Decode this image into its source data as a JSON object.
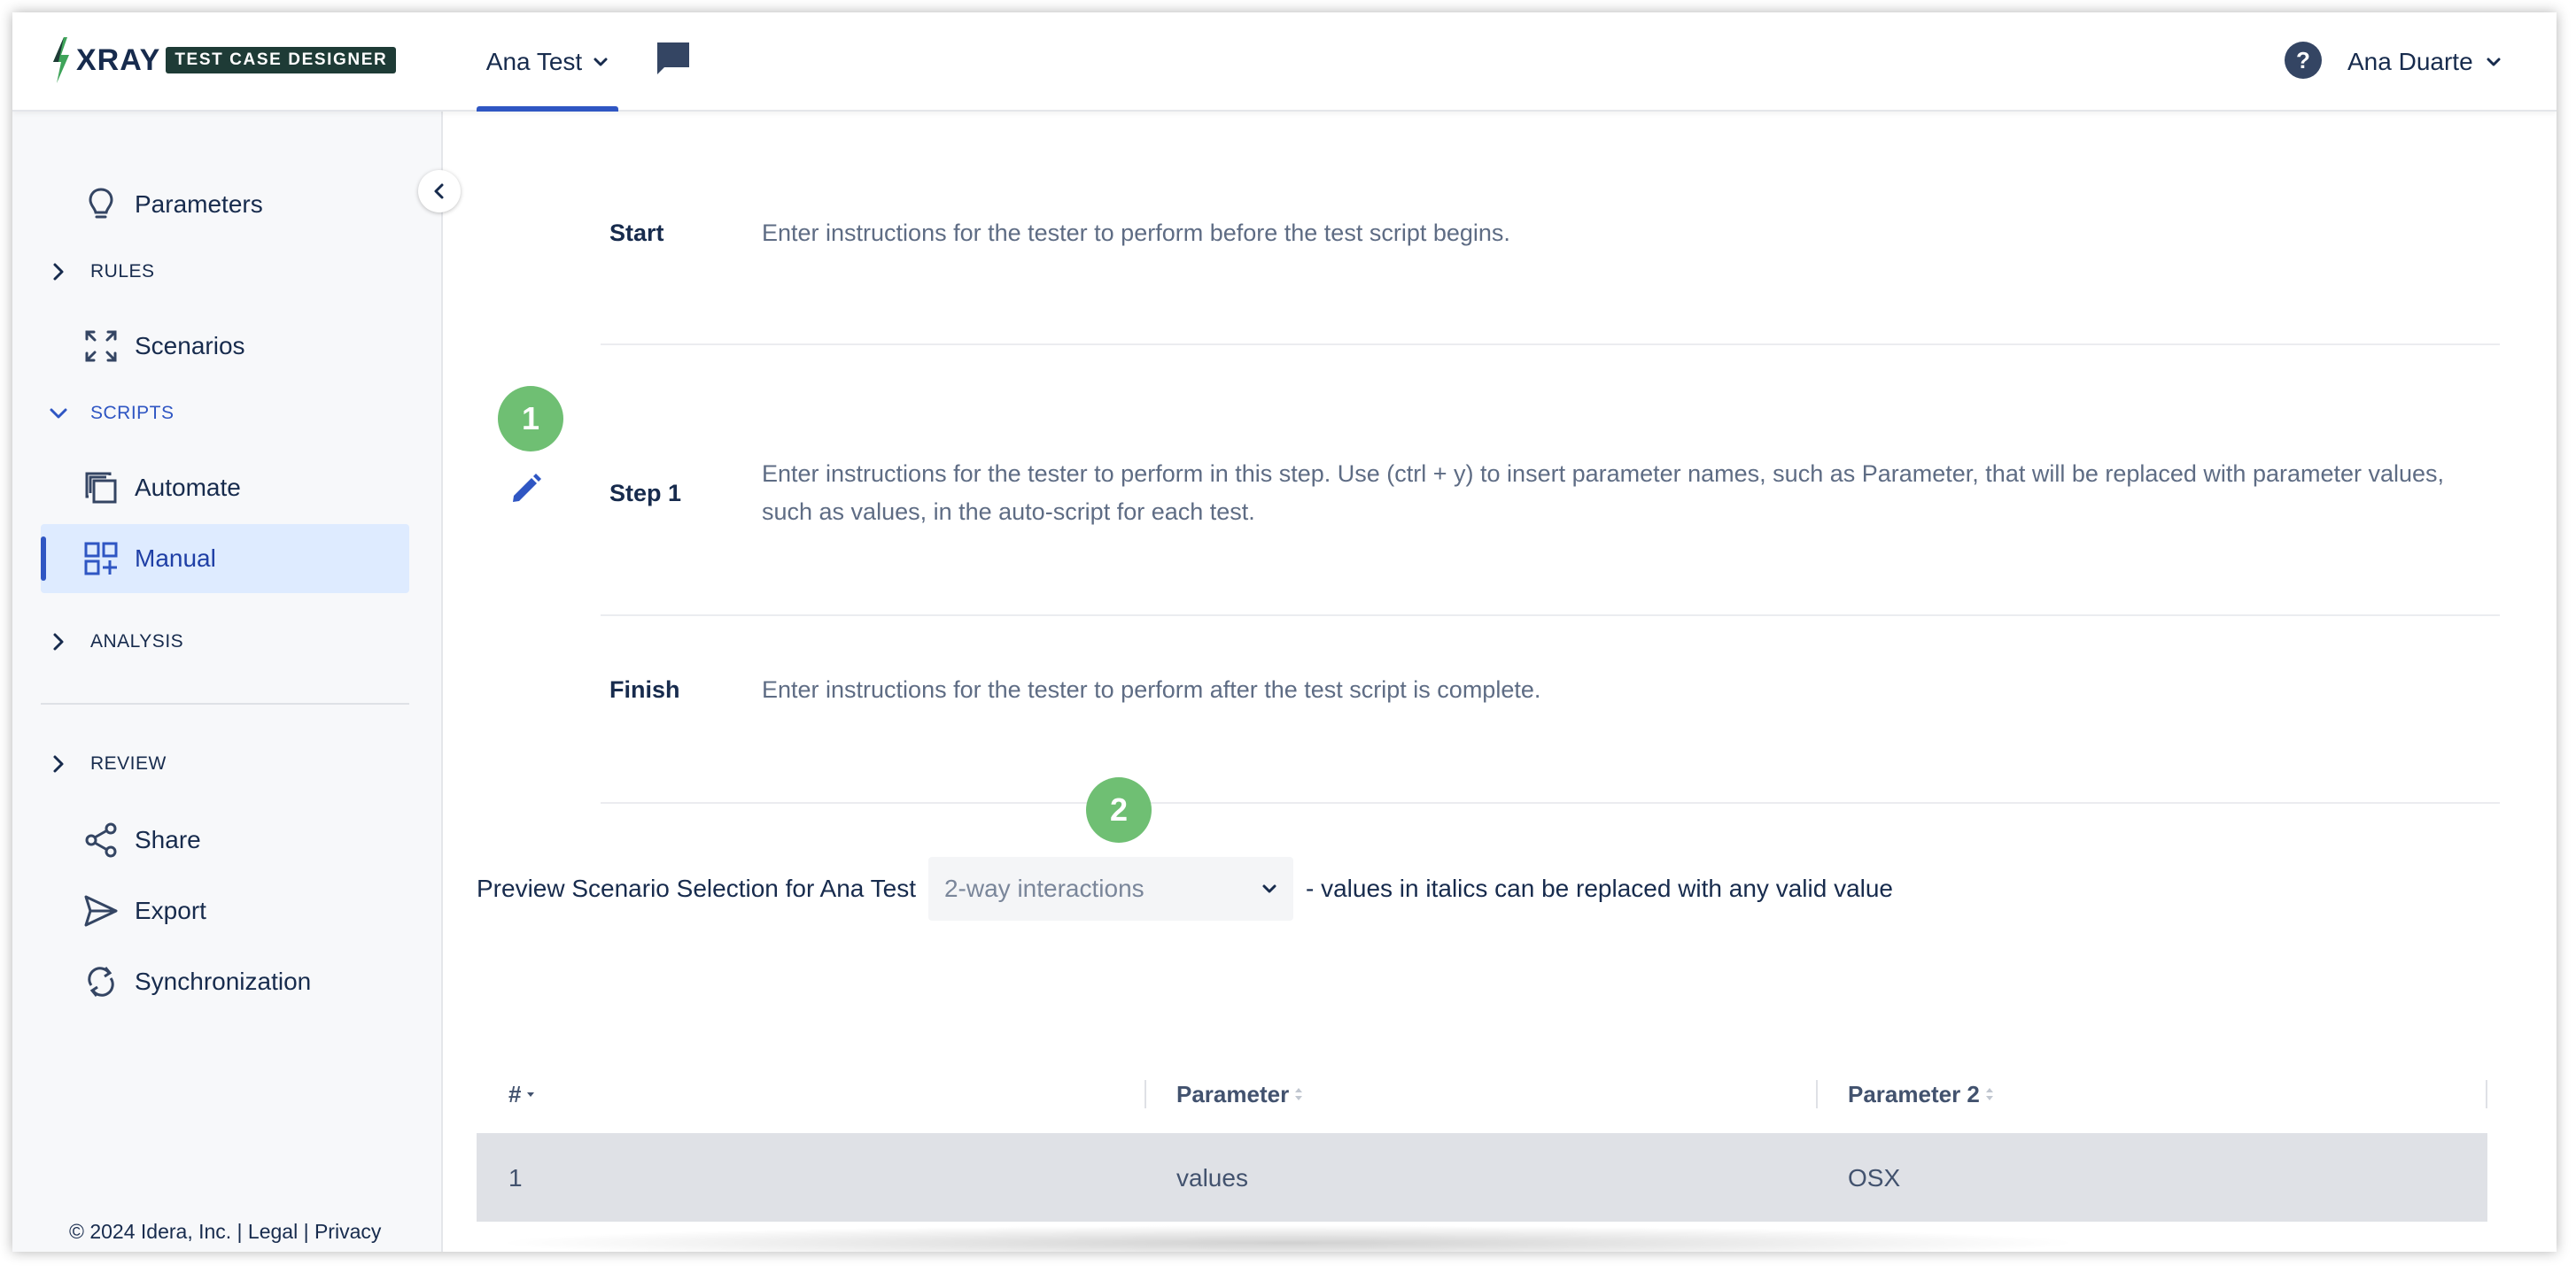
{
  "header": {
    "logo_text": "XRAY",
    "logo_subtitle": "TEST CASE DESIGNER",
    "project_name": "Ana Test",
    "user_name": "Ana Duarte"
  },
  "sidebar": {
    "items": [
      {
        "label": "Parameters",
        "icon": "lightbulb-icon"
      },
      {
        "label": "RULES",
        "icon": "chevron-right-icon",
        "section": true
      },
      {
        "label": "Scenarios",
        "icon": "expand-arrows-icon"
      },
      {
        "label": "SCRIPTS",
        "icon": "chevron-down-icon",
        "section": true,
        "open": true
      },
      {
        "label": "Automate",
        "icon": "copy-icon"
      },
      {
        "label": "Manual",
        "icon": "grid-add-icon",
        "active": true
      },
      {
        "label": "ANALYSIS",
        "icon": "chevron-right-icon",
        "section": true
      },
      {
        "label": "REVIEW",
        "icon": "chevron-right-icon",
        "section": true
      },
      {
        "label": "Share",
        "icon": "share-icon"
      },
      {
        "label": "Export",
        "icon": "send-icon"
      },
      {
        "label": "Synchronization",
        "icon": "sync-icon"
      }
    ],
    "copyright": "© 2024 Idera, Inc. | Legal | Privacy"
  },
  "steps": [
    {
      "label": "Start",
      "text": "Enter instructions for the tester to perform before the test script begins."
    },
    {
      "label": "Step 1",
      "text": "Enter instructions for the tester to perform in this step. Use (ctrl + y) to insert parameter names, such as Parameter, that will be replaced with parameter values, such as values, in the auto-script for each test."
    },
    {
      "label": "Finish",
      "text": "Enter instructions for the tester to perform after the test script is complete."
    }
  ],
  "badges": [
    "1",
    "2"
  ],
  "preview": {
    "label": "Preview Scenario Selection for Ana Test",
    "selected": "2-way interactions",
    "note": "- values in italics can be replaced with any valid value"
  },
  "table": {
    "columns": [
      "#",
      "Parameter",
      "Parameter 2"
    ],
    "rows": [
      [
        "1",
        "values",
        "OSX"
      ]
    ]
  },
  "colors": {
    "accent": "#2f56c3",
    "badge": "#6fbf73",
    "active_bg": "#deebff",
    "logo_badge": "#1e3b36"
  }
}
